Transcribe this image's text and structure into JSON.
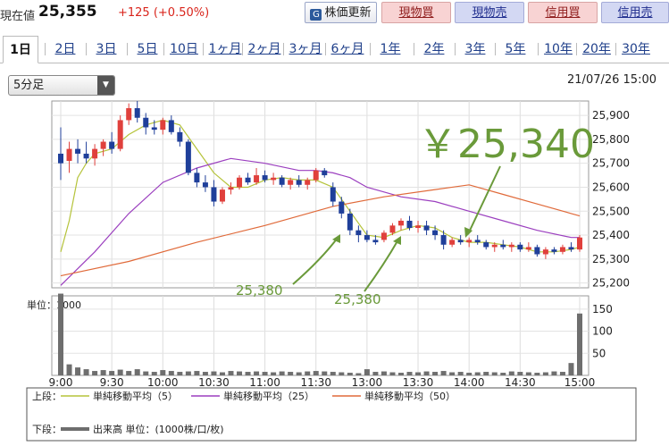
{
  "header": {
    "price_label": "現在値",
    "price_value": "25,355",
    "price_change": "+125 (+0.50%)",
    "refresh_label": "株価更新",
    "buy_label": "現物買",
    "sell_label": "現物売",
    "credit_buy_label": "信用買",
    "credit_sell_label": "信用売",
    "colors": {
      "up": "#d9241b",
      "buy_bg": "#f8d3d3",
      "sell_bg": "#d3d8f3"
    }
  },
  "tabs": [
    "1日",
    "2日",
    "3日",
    "5日",
    "10日",
    "1ヶ月",
    "2ヶ月",
    "3ヶ月",
    "6ヶ月",
    "1年",
    "2年",
    "3年",
    "5年",
    "10年",
    "20年",
    "30年"
  ],
  "active_tab": "1日",
  "interval_select": {
    "value": "5分足"
  },
  "datetime": "21/07/26 15:00",
  "chart_data": [
    {
      "type": "candlestick",
      "y_ticks": [
        "25,900",
        "25,800",
        "25,700",
        "25,600",
        "25,500",
        "25,400",
        "25,300",
        "25,200"
      ],
      "ylim": [
        25180,
        25960
      ],
      "x_ticks": [
        "9:00",
        "9:30",
        "10:00",
        "10:30",
        "11:00",
        "11:30",
        "13:00",
        "13:30",
        "14:00",
        "14:30",
        "15:00"
      ],
      "annotations": {
        "big_price": "￥25,340",
        "low1": "25,380",
        "low2": "25,380"
      },
      "candles": [
        [
          25740,
          25850,
          25630,
          25700
        ],
        [
          25710,
          25790,
          25660,
          25760
        ],
        [
          25760,
          25800,
          25700,
          25740
        ],
        [
          25740,
          25790,
          25700,
          25720
        ],
        [
          25720,
          25780,
          25690,
          25760
        ],
        [
          25760,
          25800,
          25730,
          25790
        ],
        [
          25790,
          25830,
          25740,
          25760
        ],
        [
          25760,
          25900,
          25750,
          25880
        ],
        [
          25880,
          25950,
          25860,
          25930
        ],
        [
          25930,
          25960,
          25870,
          25890
        ],
        [
          25890,
          25910,
          25820,
          25850
        ],
        [
          25850,
          25880,
          25820,
          25840
        ],
        [
          25840,
          25890,
          25820,
          25880
        ],
        [
          25880,
          25900,
          25820,
          25830
        ],
        [
          25830,
          25850,
          25770,
          25790
        ],
        [
          25790,
          25800,
          25650,
          25660
        ],
        [
          25660,
          25680,
          25600,
          25620
        ],
        [
          25620,
          25650,
          25580,
          25600
        ],
        [
          25600,
          25630,
          25520,
          25540
        ],
        [
          25540,
          25600,
          25530,
          25590
        ],
        [
          25590,
          25620,
          25570,
          25600
        ],
        [
          25600,
          25650,
          25590,
          25640
        ],
        [
          25640,
          25660,
          25610,
          25620
        ],
        [
          25620,
          25680,
          25610,
          25650
        ],
        [
          25650,
          25670,
          25620,
          25630
        ],
        [
          25630,
          25660,
          25610,
          25640
        ],
        [
          25640,
          25650,
          25600,
          25610
        ],
        [
          25610,
          25640,
          25590,
          25630
        ],
        [
          25630,
          25650,
          25600,
          25610
        ],
        [
          25610,
          25640,
          25590,
          25630
        ],
        [
          25630,
          25680,
          25620,
          25670
        ],
        [
          25670,
          25680,
          25640,
          25650
        ],
        [
          25600,
          25620,
          25520,
          25540
        ],
        [
          25540,
          25560,
          25470,
          25490
        ],
        [
          25490,
          25510,
          25400,
          25420
        ],
        [
          25420,
          25440,
          25370,
          25400
        ],
        [
          25400,
          25420,
          25370,
          25380
        ],
        [
          25380,
          25400,
          25360,
          25370
        ],
        [
          25380,
          25420,
          25370,
          25410
        ],
        [
          25410,
          25450,
          25400,
          25440
        ],
        [
          25440,
          25470,
          25420,
          25460
        ],
        [
          25460,
          25480,
          25420,
          25430
        ],
        [
          25430,
          25460,
          25410,
          25440
        ],
        [
          25440,
          25460,
          25400,
          25420
        ],
        [
          25420,
          25440,
          25380,
          25400
        ],
        [
          25400,
          25420,
          25340,
          25360
        ],
        [
          25360,
          25390,
          25350,
          25380
        ],
        [
          25380,
          25400,
          25360,
          25370
        ],
        [
          25370,
          25390,
          25350,
          25380
        ],
        [
          25380,
          25400,
          25360,
          25370
        ],
        [
          25370,
          25380,
          25340,
          25350
        ],
        [
          25350,
          25370,
          25330,
          25360
        ],
        [
          25360,
          25380,
          25340,
          25350
        ],
        [
          25350,
          25370,
          25330,
          25360
        ],
        [
          25360,
          25370,
          25330,
          25340
        ],
        [
          25340,
          25370,
          25330,
          25350
        ],
        [
          25350,
          25360,
          25310,
          25320
        ],
        [
          25320,
          25350,
          25300,
          25340
        ],
        [
          25340,
          25350,
          25320,
          25330
        ],
        [
          25330,
          25360,
          25320,
          25350
        ],
        [
          25350,
          25370,
          25330,
          25340
        ],
        [
          25340,
          25400,
          25330,
          25390
        ]
      ],
      "sma": [
        {
          "name": "単純移動平均（5）",
          "color": "#b5c33a",
          "points": [
            [
              0,
              25330
            ],
            [
              1,
              25460
            ],
            [
              2,
              25640
            ],
            [
              3,
              25700
            ],
            [
              4,
              25740
            ],
            [
              6,
              25760
            ],
            [
              8,
              25820
            ],
            [
              10,
              25860
            ],
            [
              12,
              25880
            ],
            [
              14,
              25860
            ],
            [
              16,
              25760
            ],
            [
              18,
              25660
            ],
            [
              20,
              25600
            ],
            [
              22,
              25600
            ],
            [
              24,
              25630
            ],
            [
              26,
              25640
            ],
            [
              28,
              25630
            ],
            [
              30,
              25630
            ],
            [
              32,
              25600
            ],
            [
              34,
              25500
            ],
            [
              36,
              25400
            ],
            [
              38,
              25390
            ],
            [
              40,
              25420
            ],
            [
              42,
              25440
            ],
            [
              44,
              25430
            ],
            [
              46,
              25390
            ],
            [
              48,
              25370
            ],
            [
              50,
              25370
            ],
            [
              52,
              25360
            ],
            [
              54,
              25350
            ],
            [
              56,
              25330
            ],
            [
              58,
              25330
            ],
            [
              60,
              25340
            ],
            [
              61,
              25350
            ]
          ]
        },
        {
          "name": "単純移動平均（25）",
          "color": "#9b3fbf",
          "points": [
            [
              0,
              25190
            ],
            [
              4,
              25330
            ],
            [
              8,
              25490
            ],
            [
              12,
              25620
            ],
            [
              16,
              25680
            ],
            [
              20,
              25720
            ],
            [
              24,
              25700
            ],
            [
              28,
              25670
            ],
            [
              30,
              25670
            ],
            [
              32,
              25660
            ],
            [
              34,
              25640
            ],
            [
              36,
              25600
            ],
            [
              40,
              25560
            ],
            [
              44,
              25540
            ],
            [
              48,
              25500
            ],
            [
              52,
              25460
            ],
            [
              56,
              25420
            ],
            [
              60,
              25390
            ],
            [
              61,
              25390
            ]
          ]
        },
        {
          "name": "単純移動平均（50）",
          "color": "#e06a3a",
          "points": [
            [
              0,
              25230
            ],
            [
              8,
              25290
            ],
            [
              16,
              25370
            ],
            [
              24,
              25440
            ],
            [
              32,
              25520
            ],
            [
              38,
              25560
            ],
            [
              44,
              25590
            ],
            [
              48,
              25610
            ],
            [
              52,
              25570
            ],
            [
              56,
              25530
            ],
            [
              60,
              25490
            ],
            [
              61,
              25480
            ]
          ]
        }
      ]
    },
    {
      "type": "bar",
      "unit_label": "単位：1000",
      "y_ticks": [
        "150",
        "100",
        "50"
      ],
      "ylim": [
        0,
        180
      ],
      "volumes": [
        185,
        25,
        18,
        14,
        10,
        12,
        10,
        13,
        10,
        14,
        9,
        8,
        12,
        10,
        8,
        9,
        10,
        8,
        9,
        7,
        10,
        9,
        8,
        9,
        8,
        7,
        9,
        8,
        7,
        9,
        10,
        9,
        8,
        7,
        6,
        5,
        14,
        8,
        9,
        7,
        6,
        8,
        7,
        9,
        8,
        10,
        7,
        8,
        6,
        7,
        8,
        7,
        6,
        9,
        8,
        7,
        6,
        7,
        9,
        8,
        28,
        140
      ]
    }
  ],
  "legend": {
    "upper_label": "上段：",
    "lower_label": "下段：",
    "sma5": "単純移動平均（5）",
    "sma25": "単純移動平均（25）",
    "sma50": "単純移動平均（50）",
    "volume": "出来高 単位：(1000株/口/枚)"
  }
}
